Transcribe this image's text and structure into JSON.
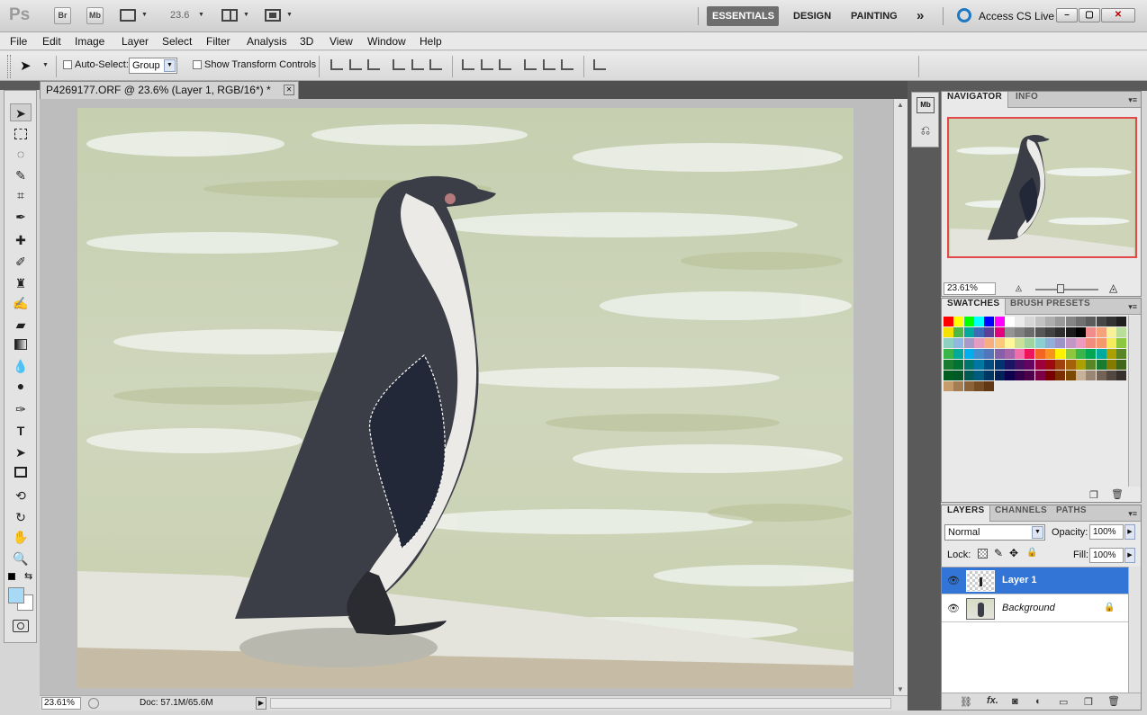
{
  "app": {
    "logo": "Ps",
    "bridge": "Br",
    "mini_bridge": "Mb",
    "zoom": "23.6"
  },
  "workspaces": [
    "ESSENTIALS",
    "DESIGN",
    "PAINTING"
  ],
  "more_workspaces": "»",
  "access_cs_live": "Access CS Live",
  "window_controls": {
    "minimize": "–",
    "restore": "▢",
    "close": "✕"
  },
  "menu": [
    "File",
    "Edit",
    "Image",
    "Layer",
    "Select",
    "Filter",
    "Analysis",
    "3D",
    "View",
    "Window",
    "Help"
  ],
  "options": {
    "auto_select_label": "Auto-Select:",
    "auto_select_value": "Group",
    "show_transform_label": "Show Transform Controls"
  },
  "document": {
    "tab_title": "P4269177.ORF @ 23.6% (Layer 1, RGB/16*) *",
    "close": "✕"
  },
  "status": {
    "zoom": "23.61%",
    "doc": "Doc: 57.1M/65.6M"
  },
  "navigator": {
    "tabs": [
      "NAVIGATOR",
      "INFO"
    ],
    "zoom": "23.61%"
  },
  "swatches": {
    "tabs": [
      "SWATCHES",
      "BRUSH PRESETS"
    ],
    "colors": [
      "#ff0000",
      "#ffff00",
      "#00ff00",
      "#00ffff",
      "#0000ff",
      "#ff00ff",
      "#ffffff",
      "#ebebeb",
      "#d6d6d6",
      "#c2c2c2",
      "#adadad",
      "#999999",
      "#858585",
      "#707070",
      "#5c5c5c",
      "#474747",
      "#333333",
      "#1f1f1f",
      "#f3e100",
      "#4cb848",
      "#00a99d",
      "#3f6ab5",
      "#5b3f99",
      "#e3007e",
      "#949494",
      "#808080",
      "#6b6b6b",
      "#575757",
      "#424242",
      "#2e2e2e",
      "#1a1a1a",
      "#000000",
      "#f28c8c",
      "#f4a37a",
      "#f8f198",
      "#b8de9a",
      "#8fd1c0",
      "#8fb7e2",
      "#a799c9",
      "#e49dc1",
      "#f7ad7d",
      "#f9c87d",
      "#fff799",
      "#cce198",
      "#a0d3a0",
      "#8ccfd0",
      "#8fafd9",
      "#9e93c7",
      "#c496c6",
      "#ee9ac0",
      "#f28c7d",
      "#f4986d",
      "#f6eb5b",
      "#8dc63f",
      "#39b54a",
      "#00a99d",
      "#00aeef",
      "#448ccb",
      "#5674b9",
      "#8560a8",
      "#a864a8",
      "#f06eaa",
      "#ed145b",
      "#f26522",
      "#f7941d",
      "#fff200",
      "#8dc63f",
      "#39b54a",
      "#00a651",
      "#00a99d",
      "#aba000",
      "#598527",
      "#197b30",
      "#007236",
      "#00746b",
      "#0076a3",
      "#004b80",
      "#003471",
      "#1b1464",
      "#440e62",
      "#630460",
      "#9e0039",
      "#9e0b0f",
      "#a0410d",
      "#a36209",
      "#aba000",
      "#598527",
      "#197b30",
      "#827b00",
      "#406618",
      "#005e20",
      "#005826",
      "#005952",
      "#005b7f",
      "#003663",
      "#002157",
      "#0d004c",
      "#32004b",
      "#4b0049",
      "#7b0046",
      "#790000",
      "#7b2e00",
      "#7d4900",
      "#c7b299",
      "#998675",
      "#736357",
      "#534741",
      "#37302d",
      "#c69c6d",
      "#a67c52",
      "#8c6239",
      "#754c24",
      "#603813"
    ]
  },
  "layers": {
    "tabs": [
      "LAYERS",
      "CHANNELS",
      "PATHS"
    ],
    "blend_mode": "Normal",
    "opacity_label": "Opacity:",
    "opacity": "100%",
    "lock_label": "Lock:",
    "fill_label": "Fill:",
    "fill": "100%",
    "items": [
      {
        "name": "Layer 1",
        "selected": true
      },
      {
        "name": "Background",
        "selected": false,
        "locked": true
      }
    ]
  }
}
